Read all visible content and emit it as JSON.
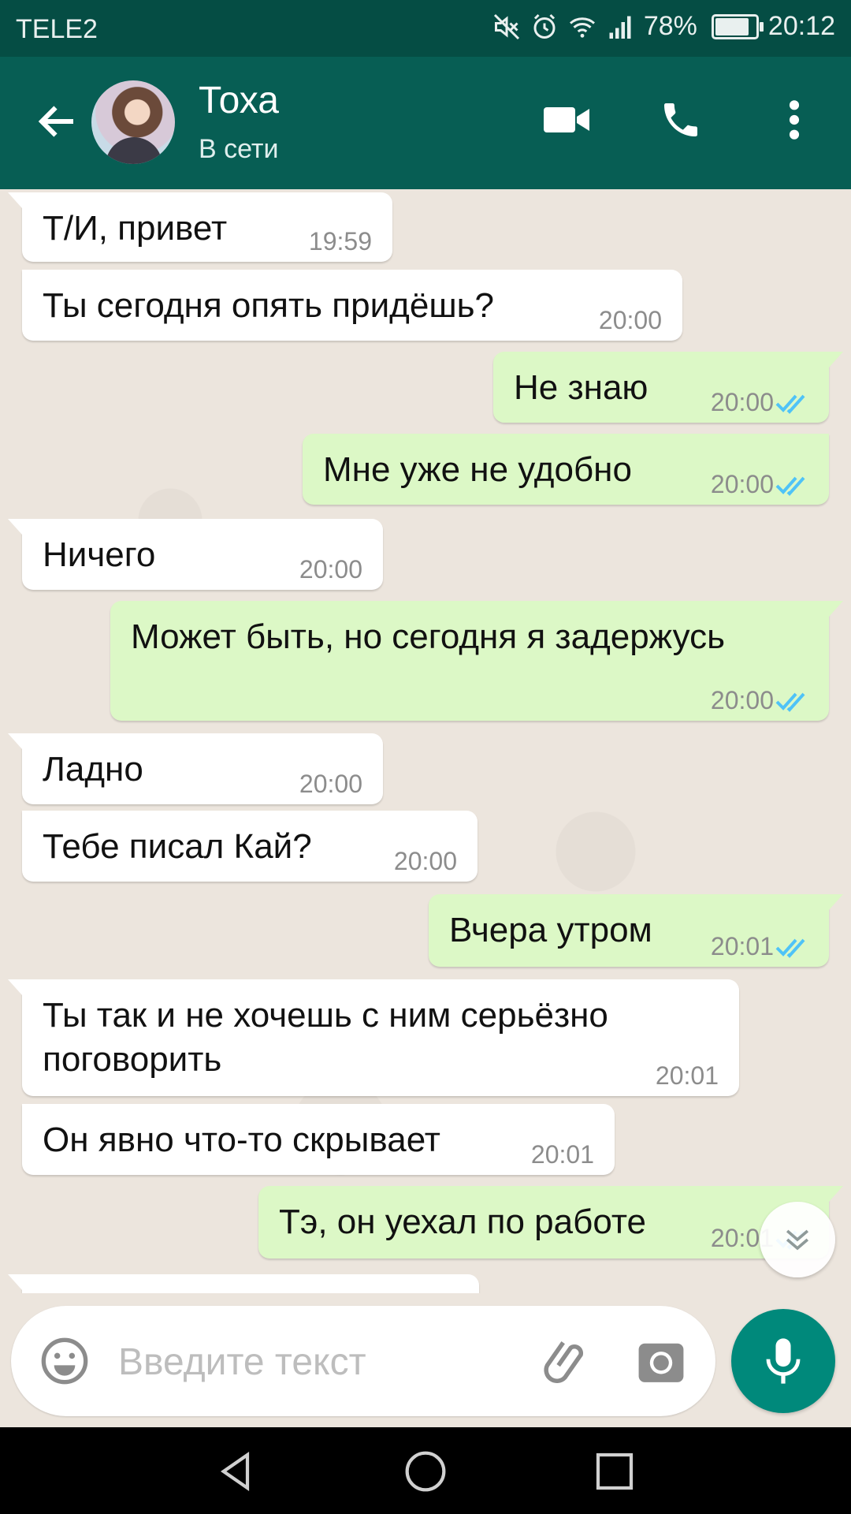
{
  "status_bar": {
    "carrier": "TELE2",
    "battery_percent": "78%",
    "battery_level": 0.78,
    "time": "20:12",
    "icons": [
      "mute-icon",
      "alarm-icon",
      "wifi-icon",
      "signal-icon",
      "battery-icon"
    ]
  },
  "header": {
    "contact_name": "Тоха",
    "contact_status": "В сети",
    "icons": [
      "back-arrow-icon",
      "avatar",
      "video-call-icon",
      "phone-icon",
      "more-vert-icon"
    ]
  },
  "messages": [
    {
      "dir": "in",
      "text": "Т/И, привет",
      "time": "19:59"
    },
    {
      "dir": "in",
      "text": "Ты сегодня опять придёшь?",
      "time": "20:00"
    },
    {
      "dir": "out",
      "text": "Не знаю",
      "time": "20:00",
      "status": "read"
    },
    {
      "dir": "out",
      "text": "Мне уже не удобно",
      "time": "20:00",
      "status": "read"
    },
    {
      "dir": "in",
      "text": "Ничего",
      "time": "20:00"
    },
    {
      "dir": "out",
      "text": "Может быть, но сегодня я задержусь",
      "time": "20:00",
      "status": "read"
    },
    {
      "dir": "in",
      "text": "Ладно",
      "time": "20:00"
    },
    {
      "dir": "in",
      "text": "Тебе писал Кай?",
      "time": "20:00"
    },
    {
      "dir": "out",
      "text": "Вчера утром",
      "time": "20:01",
      "status": "read"
    },
    {
      "dir": "in",
      "text": "Ты так и не хочешь с ним серьёзно поговорить",
      "time": "20:01"
    },
    {
      "dir": "in",
      "text": "Он явно что-то скрывает",
      "time": "20:01"
    },
    {
      "dir": "out",
      "text": "Тэ, он уехал по работе",
      "time": "20:01",
      "status": "read"
    }
  ],
  "input": {
    "placeholder": "Введите текст",
    "value": ""
  },
  "colors": {
    "status_bar": "#054d44",
    "app_bar": "#075e54",
    "chat_bg": "#ece5dd",
    "incoming_bubble": "#ffffff",
    "outgoing_bubble": "#dcf8c6",
    "read_ticks": "#4fc3f7",
    "mic_button": "#00897b"
  }
}
